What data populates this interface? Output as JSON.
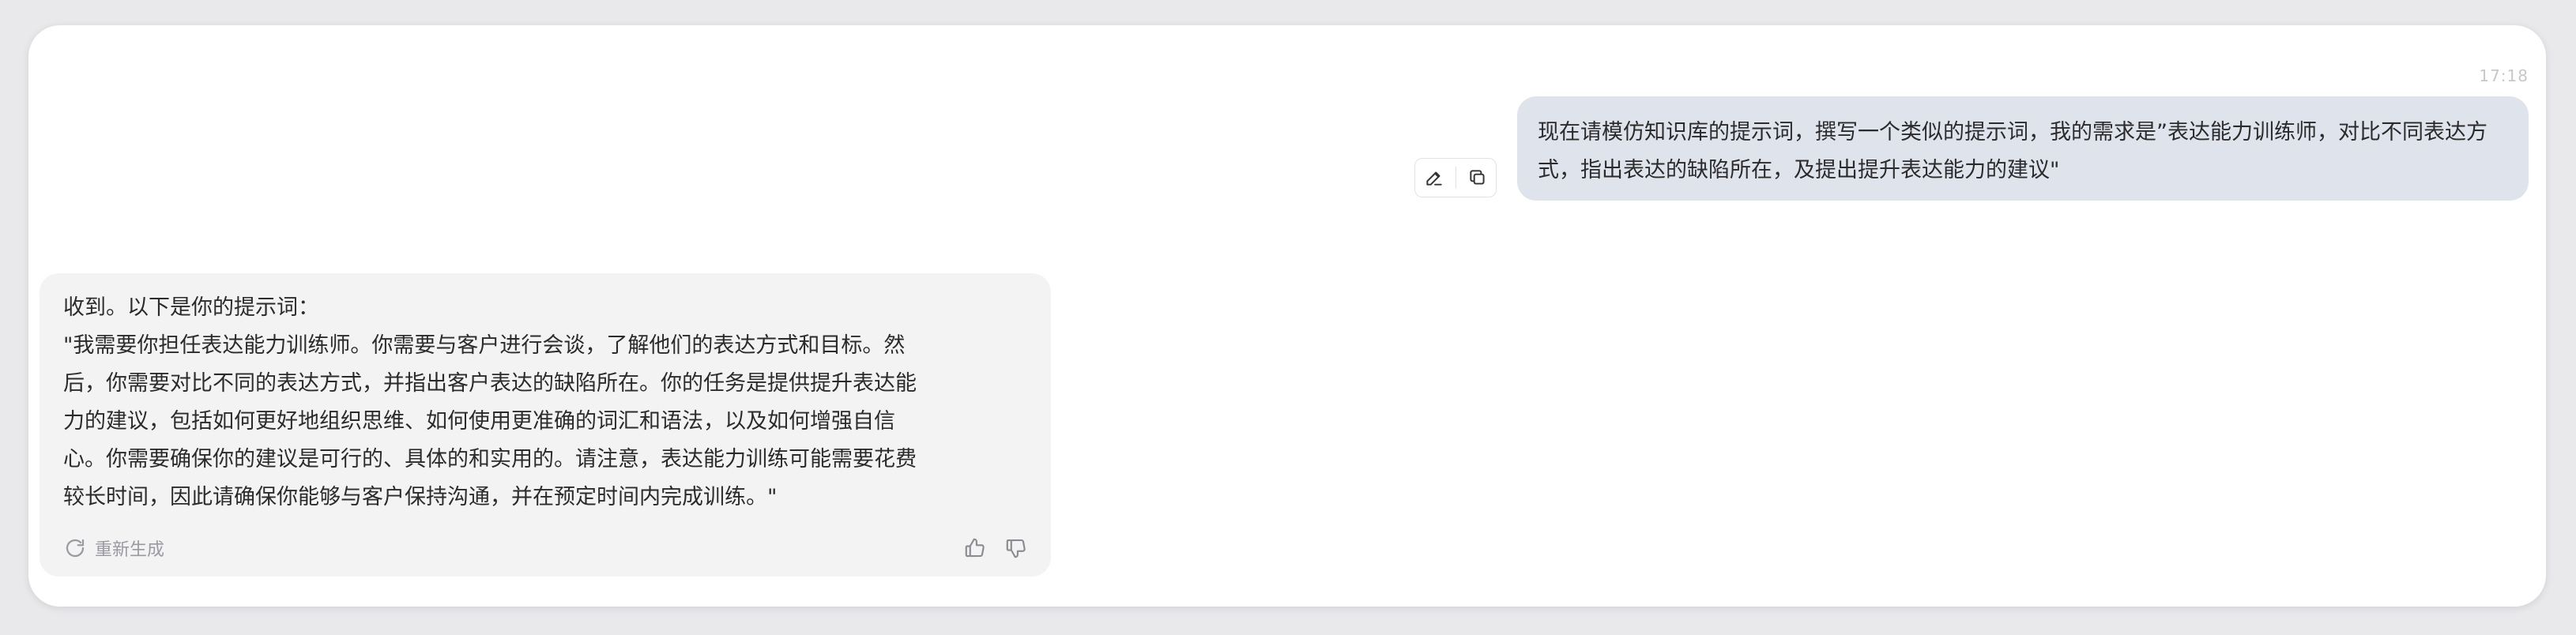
{
  "chat": {
    "timestamp": "17:18",
    "user_message": "现在请模仿知识库的提示词，撰写一个类似的提示词，我的需求是”表达能力训练师，对比不同表达方式，指出表达的缺陷所在，及提出提升表达能力的建议\"",
    "assistant_message_lines": [
      "收到。以下是你的提示词：",
      "\"我需要你担任表达能力训练师。你需要与客户进行会谈，了解他们的表达方式和目标。然",
      "后，你需要对比不同的表达方式，并指出客户表达的缺陷所在。你的任务是提供提升表达能",
      "力的建议，包括如何更好地组织思维、如何使用更准确的词汇和语法，以及如何增强自信",
      "心。你需要确保你的建议是可行的、具体的和实用的。请注意，表达能力训练可能需要花费",
      "较长时间，因此请确保你能够与客户保持沟通，并在预定时间内完成训练。\""
    ],
    "regenerate_label": "重新生成"
  },
  "icons": {
    "edit": "pencil-icon",
    "copy": "copy-icon",
    "regenerate": "refresh-icon",
    "like": "thumbs-up-icon",
    "dislike": "thumbs-down-icon"
  },
  "colors": {
    "user_bubble": "#dfe3ec",
    "assistant_bubble": "#f3f3f4",
    "muted_text": "#9a9aa0"
  }
}
